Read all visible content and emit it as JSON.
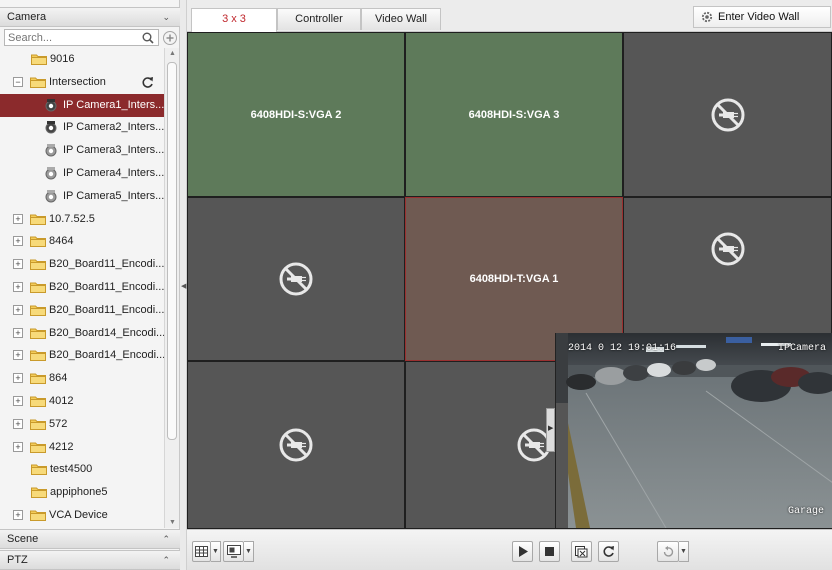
{
  "left_panel": {
    "camera_header": "Camera",
    "search": {
      "placeholder": "Search..."
    },
    "tree": [
      {
        "label": "9016",
        "type": "folder",
        "expander": ""
      },
      {
        "label": "Intersection",
        "type": "folder",
        "expander": "−"
      },
      {
        "label": "IP Camera1_Inters...",
        "type": "camera",
        "selected": true
      },
      {
        "label": "IP Camera2_Inters...",
        "type": "camera"
      },
      {
        "label": "IP Camera3_Inters...",
        "type": "camera"
      },
      {
        "label": "IP Camera4_Inters...",
        "type": "camera"
      },
      {
        "label": "IP Camera5_Inters...",
        "type": "camera"
      },
      {
        "label": "10.7.52.5",
        "type": "folder",
        "expander": "+"
      },
      {
        "label": "8464",
        "type": "folder",
        "expander": "+"
      },
      {
        "label": "B20_Board11_Encodi...",
        "type": "folder",
        "expander": "+"
      },
      {
        "label": "B20_Board11_Encodi...",
        "type": "folder",
        "expander": "+"
      },
      {
        "label": "B20_Board11_Encodi...",
        "type": "folder",
        "expander": "+"
      },
      {
        "label": "B20_Board14_Encodi...",
        "type": "folder",
        "expander": "+"
      },
      {
        "label": "B20_Board14_Encodi...",
        "type": "folder",
        "expander": "+"
      },
      {
        "label": "864",
        "type": "folder",
        "expander": "+"
      },
      {
        "label": "4012",
        "type": "folder",
        "expander": "+"
      },
      {
        "label": "572",
        "type": "folder",
        "expander": "+"
      },
      {
        "label": "4212",
        "type": "folder",
        "expander": "+"
      },
      {
        "label": "test4500",
        "type": "folder",
        "expander": ""
      },
      {
        "label": "appiphone5",
        "type": "folder",
        "expander": ""
      },
      {
        "label": "VCA Device",
        "type": "folder",
        "expander": "+"
      }
    ],
    "scene_header": "Scene",
    "ptz_header": "PTZ"
  },
  "tabs": [
    "3 x 3",
    "Controller",
    "Video Wall"
  ],
  "enter_config_label": "Enter Video Wall Config",
  "grid": {
    "cells": [
      {
        "label": "6408HDI-S:VGA 2",
        "state": "green"
      },
      {
        "label": "6408HDI-S:VGA 3",
        "state": "green"
      },
      {
        "label": "",
        "state": "noconn"
      },
      {
        "label": "",
        "state": "noconn"
      },
      {
        "label": "6408HDI-T:VGA 1",
        "state": "red"
      },
      {
        "label": "",
        "state": "noconn"
      },
      {
        "label": "",
        "state": "noconn"
      },
      {
        "label": "",
        "state": "noconn"
      },
      {
        "label": "",
        "state": "video"
      }
    ]
  },
  "video_osd": {
    "timestamp": "2014 0  12  19:01:16",
    "camera_name": "IPCamera",
    "location": "Garage"
  },
  "colors": {
    "selected_row": "#8b2a2c",
    "active_tab_text": "#c0272d",
    "cell_green": "#5e7a5a",
    "cell_red": "#6f5a52",
    "cell_gray": "#565656"
  }
}
